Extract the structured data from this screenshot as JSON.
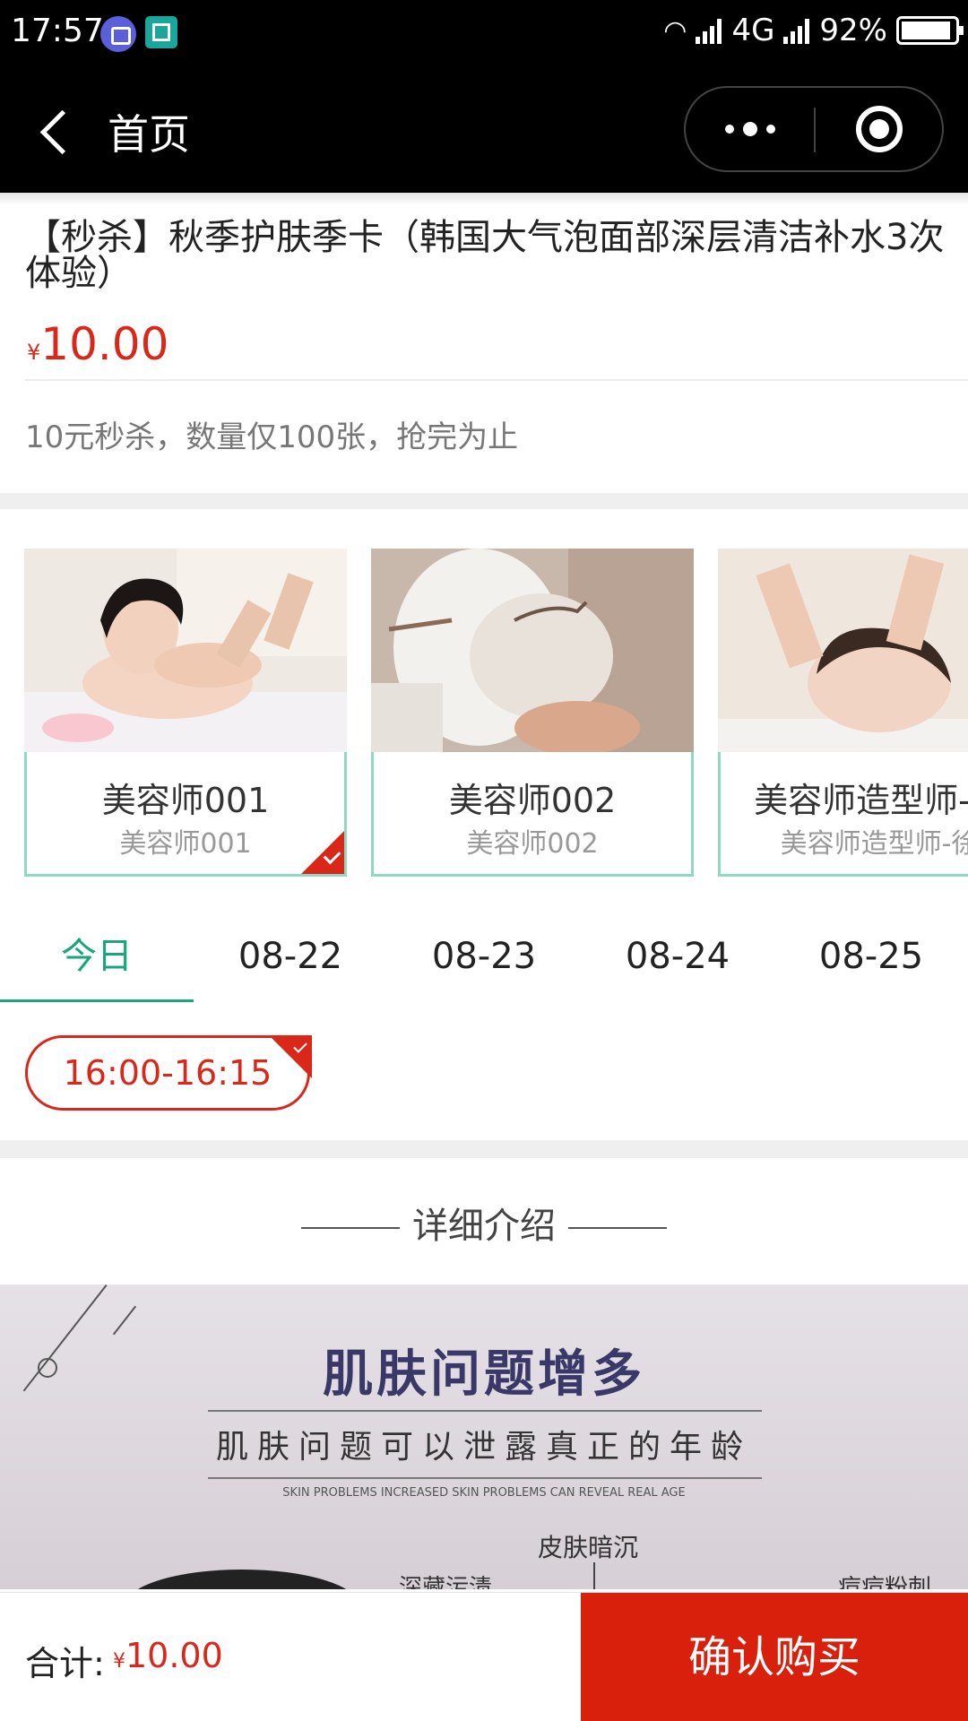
{
  "status_bar": {
    "time": "17:57",
    "network": "4G",
    "battery": "92%"
  },
  "nav": {
    "title": "首页"
  },
  "product": {
    "title": "【秒杀】秋季护肤季卡（韩国大气泡面部深层清洁补水3次体验）",
    "currency": "¥",
    "price": "10.00",
    "description": "10元秒杀，数量仅100张，抢完为止"
  },
  "staff": [
    {
      "name": "美容师001",
      "subtitle": "美容师001",
      "selected": true
    },
    {
      "name": "美容师002",
      "subtitle": "美容师002",
      "selected": false
    },
    {
      "name": "美容师造型师-徐",
      "subtitle": "美容师造型师-徐",
      "selected": false
    }
  ],
  "dates": [
    {
      "label": "今日",
      "active": true
    },
    {
      "label": "08-22",
      "active": false
    },
    {
      "label": "08-23",
      "active": false
    },
    {
      "label": "08-24",
      "active": false
    },
    {
      "label": "08-25",
      "active": false
    }
  ],
  "time_slot": {
    "label": "16:00-16:15",
    "selected": true
  },
  "detail": {
    "heading": "详细介绍",
    "banner": {
      "title": "肌肤问题增多",
      "subtitle": "肌肤问题可以泄露真正的年龄",
      "english": "SKIN PROBLEMS INCREASED SKIN PROBLEMS CAN REVEAL REAL AGE",
      "label_1": "皮肤暗沉",
      "label_2": "深藏污渍",
      "label_3": "痘痘粉刺"
    }
  },
  "footer": {
    "total_label": "合计:",
    "currency": "¥",
    "total": "10.00",
    "buy_label": "确认购买"
  },
  "colors": {
    "accent_red": "#d9281a",
    "accent_green": "#1aa67c",
    "card_border": "#8ed9c2"
  }
}
